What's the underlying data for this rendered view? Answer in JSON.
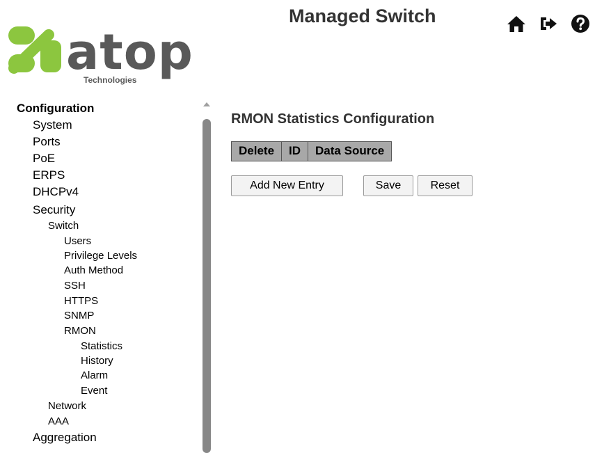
{
  "header": {
    "logo_text": "atop",
    "logo_subtext": "Technologies",
    "title": "Managed Switch",
    "icons": [
      "home-icon",
      "logout-icon",
      "help-icon"
    ]
  },
  "sidebar": {
    "items": [
      {
        "label": "Configuration",
        "level": 0
      },
      {
        "label": "System",
        "level": 1
      },
      {
        "label": "Ports",
        "level": 1
      },
      {
        "label": "PoE",
        "level": 1
      },
      {
        "label": "ERPS",
        "level": 1
      },
      {
        "label": "DHCPv4",
        "level": 1
      },
      {
        "label": "Security",
        "level": 1
      },
      {
        "label": "Switch",
        "level": 2
      },
      {
        "label": "Users",
        "level": 3
      },
      {
        "label": "Privilege Levels",
        "level": 3
      },
      {
        "label": "Auth Method",
        "level": 3
      },
      {
        "label": "SSH",
        "level": 3
      },
      {
        "label": "HTTPS",
        "level": 3
      },
      {
        "label": "SNMP",
        "level": 3
      },
      {
        "label": "RMON",
        "level": 3
      },
      {
        "label": "Statistics",
        "level": 4
      },
      {
        "label": "History",
        "level": 4
      },
      {
        "label": "Alarm",
        "level": 4
      },
      {
        "label": "Event",
        "level": 4
      },
      {
        "label": "Network",
        "level": 2
      },
      {
        "label": "AAA",
        "level": 2
      },
      {
        "label": "Aggregation",
        "level": 1
      }
    ]
  },
  "main": {
    "title": "RMON Statistics Configuration",
    "table": {
      "columns": [
        "Delete",
        "ID",
        "Data Source"
      ]
    },
    "buttons": {
      "add_new_entry": "Add New Entry",
      "save": "Save",
      "reset": "Reset"
    }
  },
  "colors": {
    "logo_green": "#8cc63f",
    "logo_gray": "#595959",
    "table_header_bg": "#a8a8a8"
  }
}
